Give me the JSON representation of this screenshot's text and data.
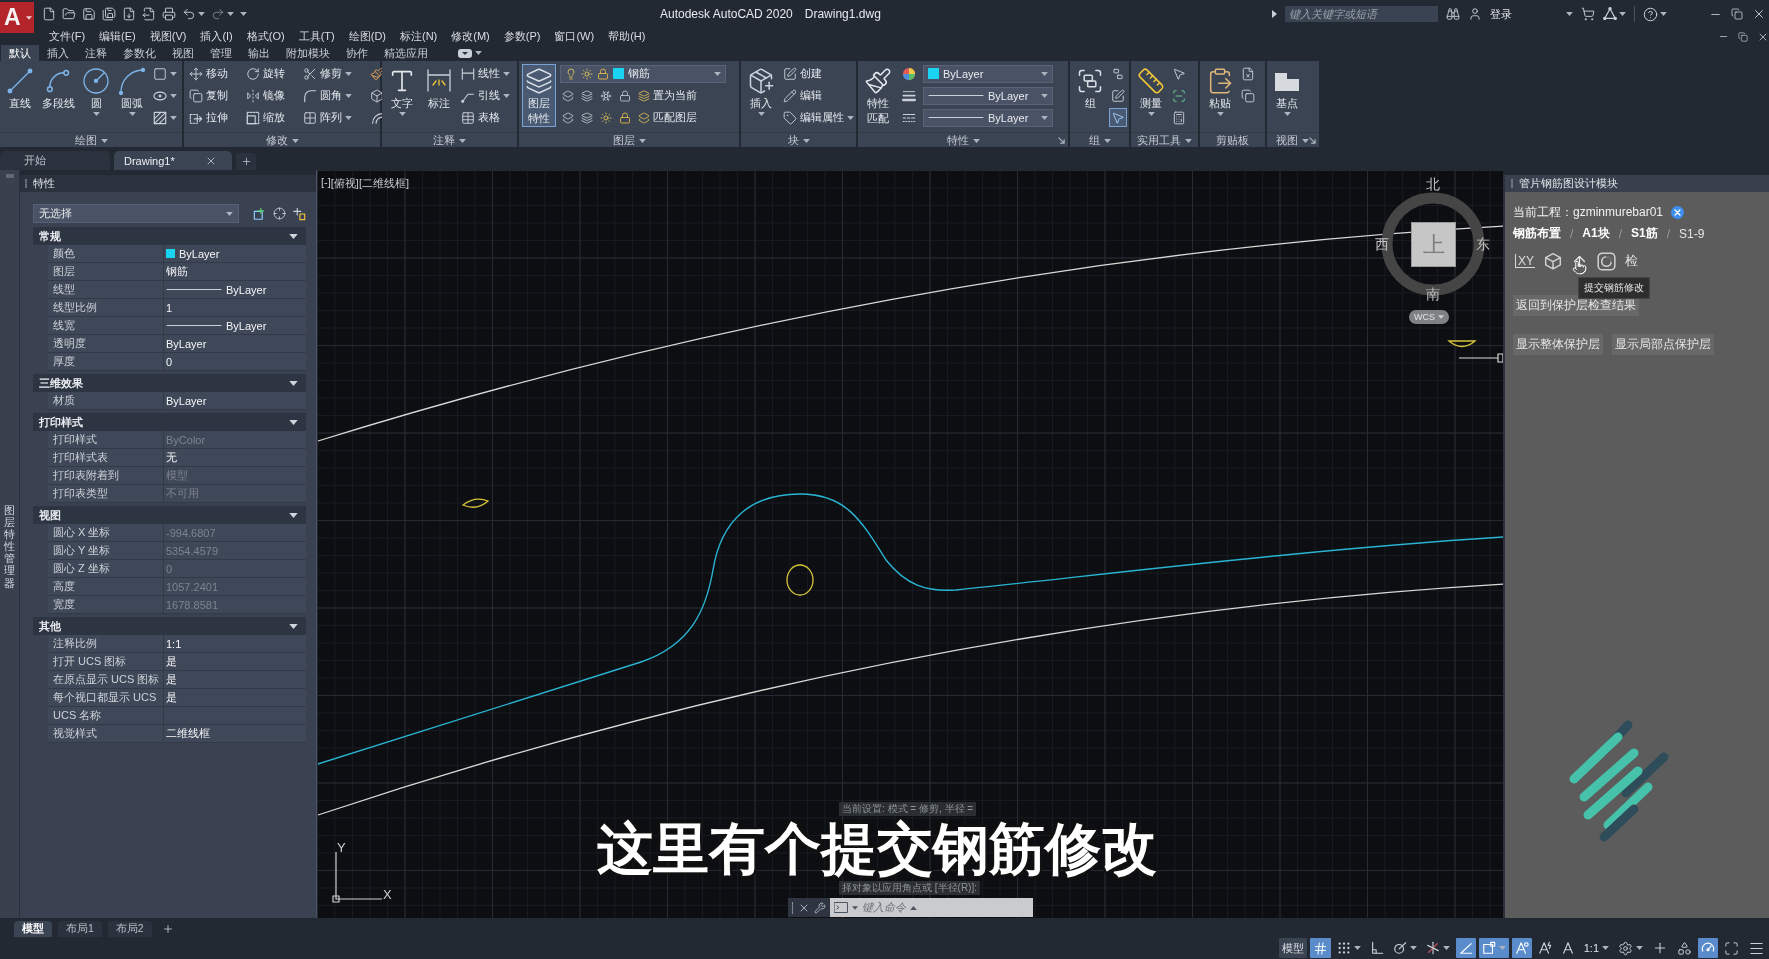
{
  "title_bar": {
    "logo": "A",
    "app_title": "Autodesk AutoCAD 2020",
    "document_title": "Drawing1.dwg",
    "search": {
      "placeholder": "键入关键字或短语"
    },
    "sign_in": "登录"
  },
  "menu_bar": [
    "文件(F)",
    "编辑(E)",
    "视图(V)",
    "插入(I)",
    "格式(O)",
    "工具(T)",
    "绘图(D)",
    "标注(N)",
    "修改(M)",
    "参数(P)",
    "窗口(W)",
    "帮助(H)"
  ],
  "ribbon": {
    "tabs": [
      {
        "label": "默认",
        "selected": true
      },
      {
        "label": "插入",
        "selected": false
      },
      {
        "label": "注释",
        "selected": false
      },
      {
        "label": "参数化",
        "selected": false
      },
      {
        "label": "视图",
        "selected": false
      },
      {
        "label": "管理",
        "selected": false
      },
      {
        "label": "输出",
        "selected": false
      },
      {
        "label": "附加模块",
        "selected": false
      },
      {
        "label": "协作",
        "selected": false
      },
      {
        "label": "精选应用",
        "selected": false
      }
    ],
    "panels": [
      {
        "title": "绘图",
        "menu": true,
        "large": [
          {
            "label": "直线",
            "active": false
          },
          {
            "label": "多段线",
            "active": false
          },
          {
            "label": "圆",
            "dropdown": true,
            "active": false
          },
          {
            "label": "圆弧",
            "dropdown": true,
            "active": false
          }
        ],
        "columns": [
          [
            [
              {
                "kind": "icon",
                "dropdown": true,
                "active": false
              }
            ],
            [
              {
                "kind": "icon",
                "dropdown": true,
                "active": false
              }
            ],
            [
              {
                "kind": "icon",
                "dropdown": true,
                "active": false
              }
            ]
          ]
        ]
      },
      {
        "title": "修改",
        "menu": true,
        "columns": [
          [
            [
              {
                "kind": "button",
                "label": "移动",
                "active": false
              }
            ],
            [
              {
                "kind": "button",
                "label": "复制",
                "active": false
              }
            ],
            [
              {
                "kind": "button",
                "label": "拉伸",
                "active": false
              }
            ]
          ],
          [
            [
              {
                "kind": "button",
                "label": "旋转",
                "active": false
              }
            ],
            [
              {
                "kind": "button",
                "label": "镜像",
                "active": false
              }
            ],
            [
              {
                "kind": "button",
                "label": "缩放",
                "active": false
              }
            ]
          ],
          [
            [
              {
                "kind": "button",
                "label": "修剪",
                "dropdown": true,
                "active": false
              }
            ],
            [
              {
                "kind": "button",
                "label": "圆角",
                "dropdown": true,
                "active": false
              }
            ],
            [
              {
                "kind": "button",
                "label": "阵列",
                "dropdown": true,
                "active": false
              }
            ]
          ],
          [
            [
              {
                "kind": "icon",
                "active": false
              }
            ],
            [
              {
                "kind": "icon",
                "active": false
              }
            ],
            [
              {
                "kind": "icon",
                "active": false
              }
            ]
          ]
        ]
      },
      {
        "title": "注释",
        "menu": true,
        "large": [
          {
            "label": "文字",
            "dropdown": true,
            "active": false
          },
          {
            "label": "标注",
            "active": false
          }
        ],
        "columns": [
          [
            [
              {
                "kind": "button",
                "label": "线性",
                "dropdown": true,
                "active": false
              }
            ],
            [
              {
                "kind": "button",
                "label": "引线",
                "dropdown": true,
                "active": false
              }
            ],
            [
              {
                "kind": "button",
                "label": "表格",
                "active": false
              }
            ]
          ]
        ]
      },
      {
        "title": "图层",
        "menu": true,
        "large": [
          {
            "lines": [
              "图层",
              "特性"
            ],
            "active": true
          }
        ],
        "columns": [
          [
            [
              {
                "kind": "layer-select",
                "label": "钢筋",
                "color": "#19d4f0"
              }
            ],
            [
              {
                "kind": "icon",
                "active": false
              },
              {
                "kind": "icon",
                "active": false
              },
              {
                "kind": "icon",
                "active": false
              },
              {
                "kind": "icon",
                "active": false
              },
              {
                "kind": "button",
                "label": "置为当前",
                "active": false
              }
            ],
            [
              {
                "kind": "icon",
                "active": false
              },
              {
                "kind": "icon",
                "active": false
              },
              {
                "kind": "icon",
                "active": false
              },
              {
                "kind": "icon",
                "active": false
              },
              {
                "kind": "button",
                "label": "匹配图层",
                "active": false
              }
            ]
          ]
        ]
      },
      {
        "title": "块",
        "menu": true,
        "large": [
          {
            "label": "插入",
            "dropdown": true,
            "active": false
          }
        ],
        "columns": [
          [
            [
              {
                "kind": "button",
                "label": "创建",
                "active": false
              }
            ],
            [
              {
                "kind": "button",
                "label": "编辑",
                "active": false
              }
            ],
            [
              {
                "kind": "button",
                "label": "编辑属性",
                "dropdown": true,
                "active": false
              }
            ]
          ]
        ]
      },
      {
        "title": "特性",
        "menu": true,
        "launcher": true,
        "large": [
          {
            "lines": [
              "特性",
              "匹配"
            ],
            "active": false
          }
        ],
        "columns": [
          [
            [
              {
                "kind": "icon",
                "active": false
              }
            ],
            [
              {
                "kind": "icon",
                "active": false
              }
            ],
            [
              {
                "kind": "icon",
                "active": false
              }
            ]
          ],
          [
            [
              {
                "kind": "color-select",
                "label": "ByLayer",
                "color": "#19d4f0"
              }
            ],
            [
              {
                "kind": "line-select",
                "label": "ByLayer"
              }
            ],
            [
              {
                "kind": "line-select",
                "label": "ByLayer"
              }
            ]
          ]
        ]
      },
      {
        "title": "组",
        "menu": true,
        "large": [
          {
            "label": "组",
            "active": false
          }
        ],
        "columns": [
          [
            [
              {
                "kind": "icon",
                "active": false
              }
            ],
            [
              {
                "kind": "icon",
                "active": false
              }
            ],
            [
              {
                "kind": "icon",
                "active": true
              }
            ]
          ]
        ]
      },
      {
        "title": "实用工具",
        "menu": true,
        "large": [
          {
            "label": "测量",
            "dropdown": true,
            "active": false
          }
        ],
        "columns": [
          [
            [
              {
                "kind": "icon",
                "active": false
              }
            ],
            [
              {
                "kind": "icon",
                "active": false
              }
            ],
            [
              {
                "kind": "icon",
                "active": false
              }
            ]
          ]
        ]
      },
      {
        "title": "剪贴板",
        "large": [
          {
            "label": "粘贴",
            "dropdown": true,
            "active": false
          }
        ],
        "columns": [
          [
            [
              {
                "kind": "icon",
                "active": false
              }
            ],
            [
              {
                "kind": "icon",
                "active": false
              }
            ]
          ]
        ]
      },
      {
        "title": "视图",
        "menu": true,
        "launcher": true,
        "large": [
          {
            "label": "基点",
            "dropdown": true,
            "active": false
          }
        ]
      }
    ]
  },
  "file_tabs": [
    {
      "label": "开始",
      "selected": false
    },
    {
      "label": "Drawing1*",
      "selected": true,
      "closable": true
    }
  ],
  "side_strip": {
    "label": "图层特性管理器"
  },
  "properties": {
    "title": "特性",
    "selection": "无选择",
    "sections": [
      {
        "title": "常规",
        "expanded": true,
        "rows": [
          {
            "label": "颜色",
            "value": "ByLayer",
            "kind": "swatch",
            "color": "#19d4f0",
            "disabled": false
          },
          {
            "label": "图层",
            "value": "钢筋",
            "kind": "text",
            "disabled": false
          },
          {
            "label": "线型",
            "value": "ByLayer",
            "kind": "line",
            "disabled": false
          },
          {
            "label": "线型比例",
            "value": "1",
            "kind": "text",
            "disabled": false
          },
          {
            "label": "线宽",
            "value": "ByLayer",
            "kind": "line",
            "disabled": false
          },
          {
            "label": "透明度",
            "value": "ByLayer",
            "kind": "text",
            "disabled": false
          },
          {
            "label": "厚度",
            "value": "0",
            "kind": "text",
            "disabled": false
          }
        ]
      },
      {
        "title": "三维效果",
        "expanded": true,
        "rows": [
          {
            "label": "材质",
            "value": "ByLayer",
            "kind": "text",
            "disabled": false
          }
        ]
      },
      {
        "title": "打印样式",
        "expanded": true,
        "rows": [
          {
            "label": "打印样式",
            "value": "ByColor",
            "kind": "text",
            "disabled": true
          },
          {
            "label": "打印样式表",
            "value": "无",
            "kind": "text",
            "disabled": false
          },
          {
            "label": "打印表附着到",
            "value": "模型",
            "kind": "text",
            "disabled": true
          },
          {
            "label": "打印表类型",
            "value": "不可用",
            "kind": "text",
            "disabled": true
          }
        ]
      },
      {
        "title": "视图",
        "expanded": true,
        "rows": [
          {
            "label": "圆心 X 坐标",
            "value": "-994.6807",
            "kind": "text",
            "disabled": true
          },
          {
            "label": "圆心 Y 坐标",
            "value": "5354.4579",
            "kind": "text",
            "disabled": true
          },
          {
            "label": "圆心 Z 坐标",
            "value": "0",
            "kind": "text",
            "disabled": true
          },
          {
            "label": "高度",
            "value": "1057.2401",
            "kind": "text",
            "disabled": true
          },
          {
            "label": "宽度",
            "value": "1678.8581",
            "kind": "text",
            "disabled": true
          }
        ]
      },
      {
        "title": "其他",
        "expanded": true,
        "rows": [
          {
            "label": "注释比例",
            "value": "1:1",
            "kind": "text",
            "disabled": false
          },
          {
            "label": "打开 UCS 图标",
            "value": "是",
            "kind": "text",
            "disabled": false
          },
          {
            "label": "在原点显示 UCS 图标",
            "value": "是",
            "kind": "text",
            "disabled": false
          },
          {
            "label": "每个视口都显示 UCS",
            "value": "是",
            "kind": "text",
            "disabled": false
          },
          {
            "label": "UCS 名称",
            "kind": "text"
          },
          {
            "label": "视觉样式",
            "value": "二维线框",
            "kind": "text",
            "disabled": false
          }
        ]
      }
    ]
  },
  "viewport": {
    "controls": [
      "[-]",
      "[俯视]",
      "[二维线框]"
    ],
    "viewcube": {
      "north": "北",
      "south": "南",
      "west": "西",
      "east": "东",
      "face": "上",
      "coordinate_system": "WCS"
    },
    "ucs": {
      "x": "X",
      "y": "Y"
    },
    "command_history": [
      "当前设置: 模式 = 修剪, 半径 =",
      "择对象以应用角点或 [半径(R)]:"
    ],
    "subtitle": "这里有个提交钢筋修改",
    "command_line": {
      "placeholder": "键入命令"
    }
  },
  "plugin_panel": {
    "title": "管片钢筋图设计模块",
    "project": "当前工程：gzminmurebar01",
    "breadcrumb": [
      {
        "label": "钢筋布置",
        "current": false,
        "separator": "/"
      },
      {
        "label": "A1块",
        "current": false,
        "separator": "/"
      },
      {
        "label": "S1筋",
        "current": false,
        "separator": "/"
      },
      {
        "label": "S1-9",
        "current": true
      }
    ],
    "tools": [
      {
        "kind": "xy",
        "label": "XY",
        "hovered": false
      },
      {
        "kind": "cube",
        "hovered": false
      },
      {
        "kind": "submit",
        "hovered": true,
        "tooltip": "提交钢筋修改"
      },
      {
        "kind": "lens",
        "hovered": false
      },
      {
        "kind": "text",
        "label": "检",
        "hovered": false
      }
    ],
    "buttons": [
      [
        "返回到保护层检查结果"
      ],
      [
        "显示整体保护层",
        "显示局部点保护层"
      ]
    ]
  },
  "layout_tabs": [
    {
      "label": "模型",
      "selected": true
    },
    {
      "label": "布局1",
      "selected": false
    },
    {
      "label": "布局2",
      "selected": false
    }
  ],
  "status_bar": [
    {
      "kind": "space",
      "label": "模型",
      "on": false
    },
    {
      "kind": "grid",
      "on": true
    },
    {
      "kind": "snap",
      "on": false,
      "dropdown": true
    },
    {
      "kind": "ortho",
      "on": false
    },
    {
      "kind": "polar",
      "on": false,
      "dropdown": true
    },
    {
      "kind": "isodraft",
      "on": false,
      "dropdown": true
    },
    {
      "kind": "tracking",
      "on": true
    },
    {
      "kind": "osnap",
      "on": true,
      "dropdown": true
    },
    {
      "kind": "annotation-visibility",
      "on": true
    },
    {
      "kind": "autoscale",
      "on": false
    },
    {
      "kind": "annotation-scale",
      "on": false
    },
    {
      "kind": "label",
      "label": "1:1",
      "on": false,
      "dropdown": true
    },
    {
      "kind": "workspace",
      "on": false,
      "dropdown": true
    },
    {
      "kind": "plus",
      "on": false
    },
    {
      "kind": "isolate",
      "on": false
    },
    {
      "kind": "hardware",
      "on": true
    },
    {
      "kind": "fullscreen",
      "on": false
    },
    {
      "kind": "customize",
      "on": false
    }
  ]
}
